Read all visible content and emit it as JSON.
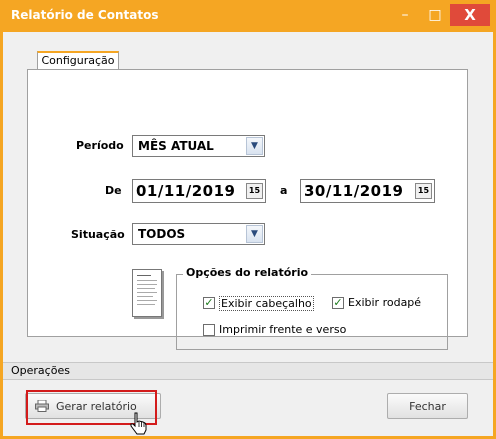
{
  "window": {
    "title": "Relatório de Contatos",
    "minimize": "–",
    "maximize": "□",
    "close": "X"
  },
  "tab": {
    "label": "Configuração"
  },
  "form": {
    "periodo": {
      "label": "Período",
      "value": "MÊS ATUAL"
    },
    "de": {
      "label": "De",
      "from": "01/11/2019",
      "sep": "a",
      "to": "30/11/2019",
      "cal_glyph": "15"
    },
    "situacao": {
      "label": "Situação",
      "value": "TODOS"
    }
  },
  "options": {
    "title": "Opções do relatório",
    "exibir_cabecalho": {
      "label": "Exibir cabeçalho",
      "checked": true
    },
    "exibir_rodape": {
      "label": "Exibir rodapé",
      "checked": true
    },
    "imprimir_frente_verso": {
      "label": "Imprimir frente e verso",
      "checked": false
    }
  },
  "operations": {
    "header": "Operações",
    "generate_label": "Gerar relatório",
    "close_label": "Fechar"
  },
  "colors": {
    "accent": "#f5a623",
    "close": "#e04a3a",
    "highlight": "#d31b1b",
    "check": "#1a7a1a"
  }
}
